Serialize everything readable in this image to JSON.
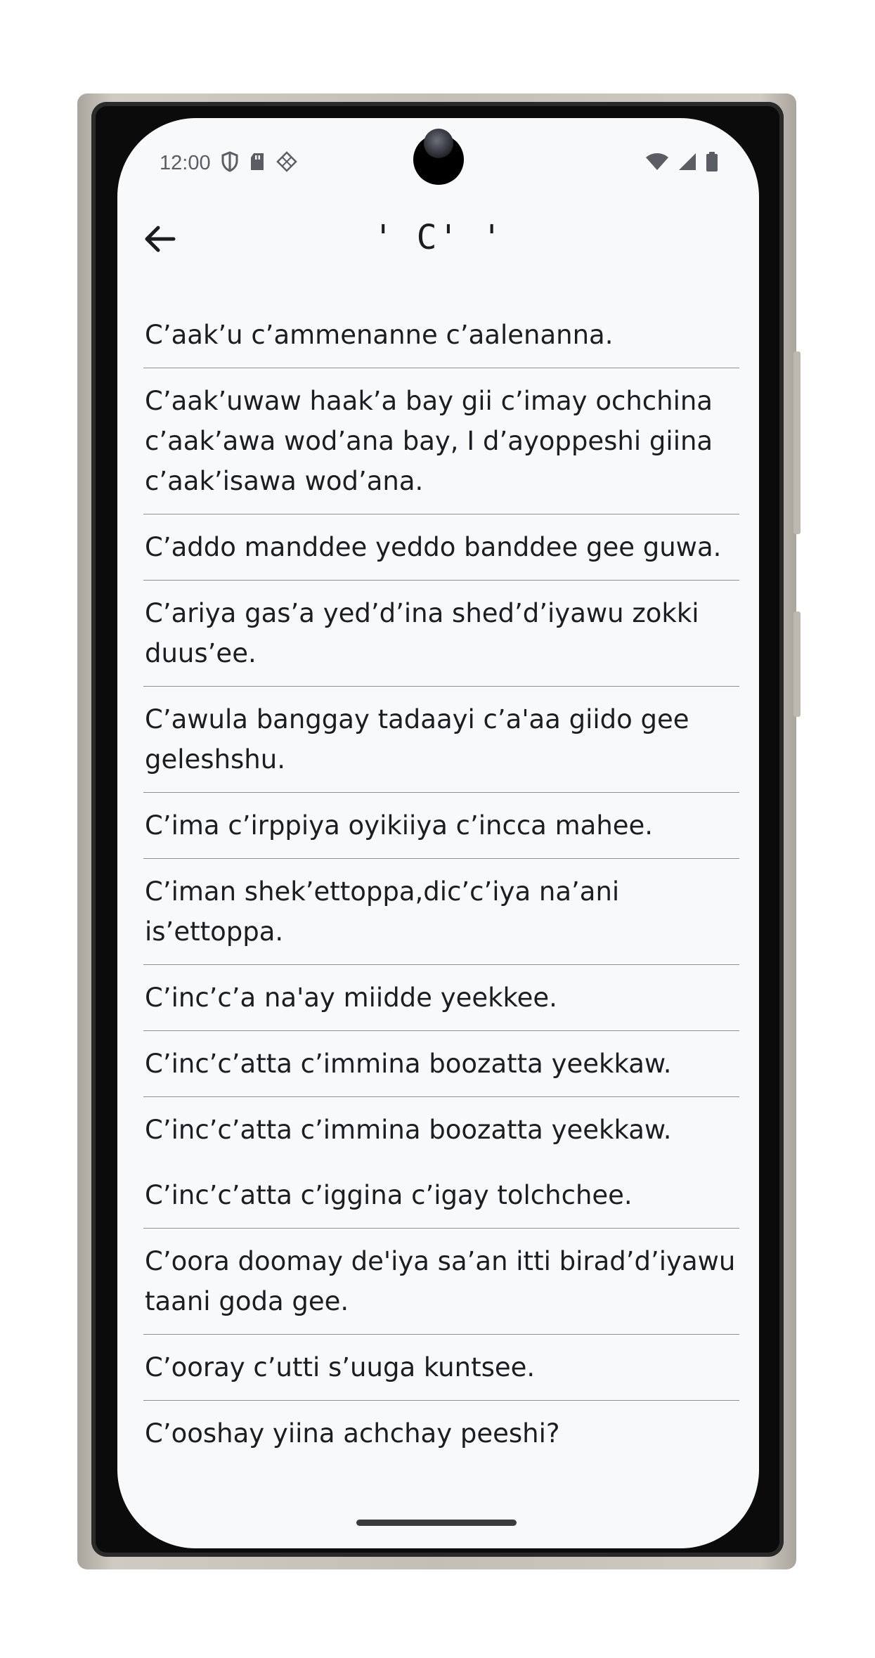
{
  "status_bar": {
    "time": "12:00",
    "left_icons": [
      "shield-icon",
      "sd-card-icon",
      "diamond-grid-icon"
    ],
    "right_icons": [
      "wifi-icon",
      "signal-icon",
      "battery-icon"
    ]
  },
  "app_bar": {
    "back_icon": "arrow-left-icon",
    "title": "' C' '"
  },
  "proverbs": [
    {
      "text": "C’aak’u c’ammenanne c’aalenanna.",
      "divider": true
    },
    {
      "text": "C’aak’uwaw haak’a bay gii c’imay ochchina c’aak’awa wod’ana bay, I d’ayoppeshi giina c’aak’isawa wod’ana.",
      "divider": true
    },
    {
      "text": "C’addo manddee yeddo banddee gee guwa.",
      "divider": true
    },
    {
      "text": "C’ariya gas’a yed’d’ina shed’d’iyawu zokki duus’ee.",
      "divider": true
    },
    {
      "text": "C’awula banggay tadaayi c’a'aa giido gee geleshshu.",
      "divider": true
    },
    {
      "text": "C’ima c’irppiya oyikiiya c’incca mahee.",
      "divider": true
    },
    {
      "text": "C’iman shek’ettoppa,dic’c’iya na’ani is’ettoppa.",
      "divider": true
    },
    {
      "text": "C’inc’c’a na'ay miidde yeekkee.",
      "divider": true
    },
    {
      "text": "C’inc’c’atta c’immina boozatta yeekkaw.",
      "divider": true
    },
    {
      "text": "C’inc’c’atta c’immina boozatta yeekkaw.",
      "divider": false
    },
    {
      "text": "C’inc’c’atta c’iggina c’igay tolchchee.",
      "divider": true
    },
    {
      "text": "C’oora doomay de'iya sa’an itti birad’d’iyawu taani goda gee.",
      "divider": true
    },
    {
      "text": "C’ooray c’utti s’uuga kuntsee.",
      "divider": true
    },
    {
      "text": "C’ooshay yiina achchay peeshi?",
      "divider": false
    }
  ],
  "colors": {
    "screen_background": "#f8f9fb",
    "text": "#1c1d21",
    "divider": "#8e9096"
  }
}
